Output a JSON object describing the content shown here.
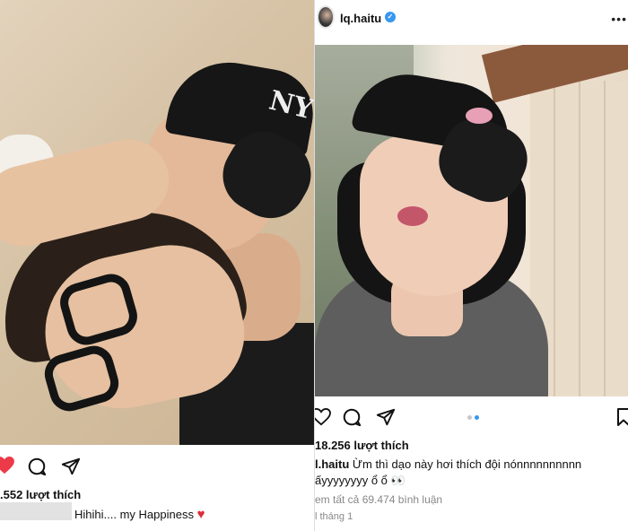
{
  "left_post": {
    "likes_text": ".552 lượt thích",
    "caption": {
      "text": "Hihihi.... my Happiness",
      "emoji": "♥"
    },
    "icons": [
      "heart-filled-icon",
      "comment-icon",
      "share-icon"
    ],
    "colors": {
      "like_red": "#ed3a49"
    }
  },
  "right_post": {
    "username": "lq.haitu",
    "verified": true,
    "more_glyph": "•••",
    "likes_text": "18.256 lượt thích",
    "caption": {
      "username": "l.haitu",
      "line1": "Ừm thì dạo này hơi thích đội nónnnnnnnnnn",
      "line2": "ấyyyyyyyy ổ ổ",
      "line2_emoji": "👀"
    },
    "view_comments": "em tất cả 69.474 bình luận",
    "timestamp": "l tháng 1",
    "carousel": {
      "count": 2,
      "active_index": 1
    },
    "icons": [
      "heart-outline-icon",
      "comment-icon",
      "share-icon",
      "bookmark-icon"
    ],
    "colors": {
      "verified_blue": "#3897f0",
      "dot_active": "#3897f0",
      "dot_inactive": "#c7c7c7"
    }
  }
}
